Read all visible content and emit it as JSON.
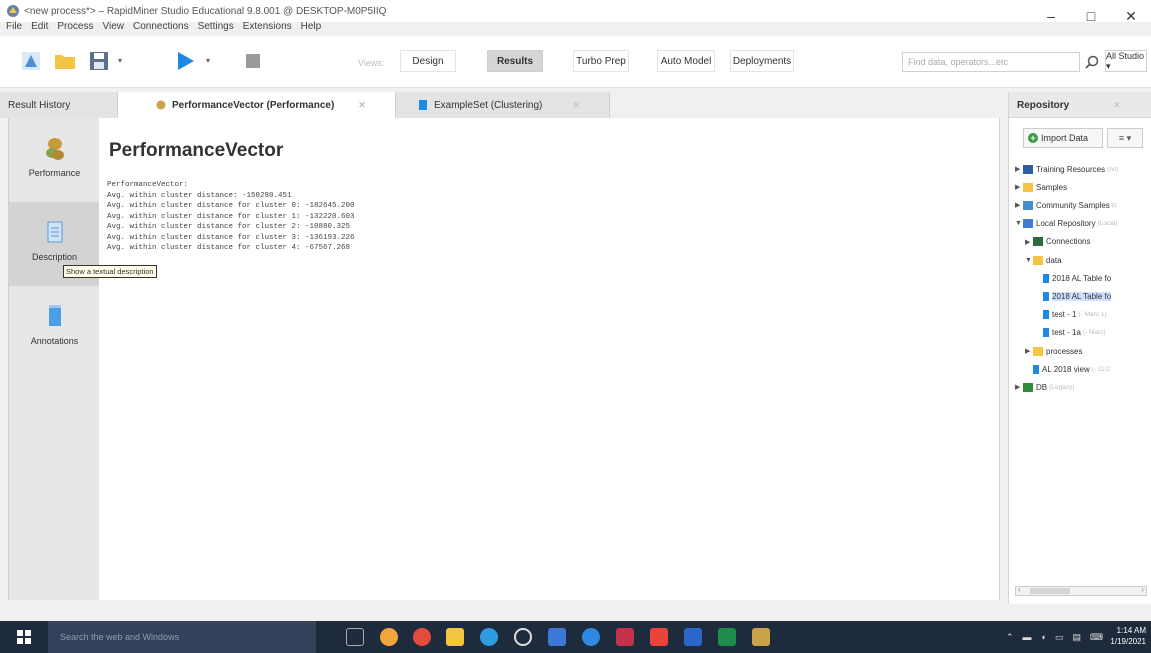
{
  "window": {
    "title": "<new process*> – RapidMiner Studio Educational 9.8.001 @ DESKTOP-M0P5IIQ",
    "minimize": "–",
    "maximize": "□",
    "close": "✕"
  },
  "menubar": [
    "File",
    "Edit",
    "Process",
    "View",
    "Connections",
    "Settings",
    "Extensions",
    "Help"
  ],
  "toolbar": {
    "views_label": "Views:",
    "views": [
      "Design",
      "Results",
      "Turbo Prep",
      "Auto Model",
      "Deployments"
    ],
    "active_view": "Results",
    "search_placeholder": "Find data, operators...etc",
    "studio_dropdown": "All Studio ▾"
  },
  "tabs": [
    {
      "label": "Result History",
      "active": false
    },
    {
      "label": "PerformanceVector (Performance)",
      "active": true
    },
    {
      "label": "ExampleSet (Clustering)",
      "active": false
    }
  ],
  "sidebar": {
    "items": [
      {
        "label": "Performance"
      },
      {
        "label": "Description"
      },
      {
        "label": "Annotations"
      }
    ],
    "tooltip": "Show a textual description"
  },
  "main": {
    "heading": "PerformanceVector",
    "lines": [
      "PerformanceVector:",
      "Avg. within cluster distance: -150280.451",
      "Avg. within cluster distance for cluster 0: -182645.200",
      "Avg. within cluster distance for cluster 1: -132220.603",
      "Avg. within cluster distance for cluster 2: -10880.325",
      "Avg. within cluster distance for cluster 3: -136193.226",
      "Avg. within cluster distance for cluster 4: -67567.268"
    ]
  },
  "repository": {
    "title": "Repository",
    "import_label": "Import Data",
    "menu_label": "≡ ▾",
    "tree": [
      {
        "label": "Training Resources",
        "meta": "(no)",
        "indent": 0,
        "twisty": "▶",
        "icon": "training"
      },
      {
        "label": "Samples",
        "meta": "",
        "indent": 0,
        "twisty": "▶",
        "icon": "folder"
      },
      {
        "label": "Community Samples",
        "meta": "(c",
        "indent": 0,
        "twisty": "▶",
        "icon": "community"
      },
      {
        "label": "Local Repository",
        "meta": "(Local)",
        "indent": 0,
        "twisty": "▼",
        "icon": "localrepo"
      },
      {
        "label": "Connections",
        "meta": "",
        "indent": 1,
        "twisty": "▶",
        "icon": "connections"
      },
      {
        "label": "data",
        "meta": "",
        "indent": 1,
        "twisty": "▼",
        "icon": "folder"
      },
      {
        "label": "2018 AL Table fo",
        "meta": "",
        "indent": 2,
        "twisty": "",
        "icon": "data",
        "selected": false
      },
      {
        "label": "2018 AL Table fo",
        "meta": "",
        "indent": 2,
        "twisty": "",
        "icon": "data",
        "selected": true
      },
      {
        "label": "test - 1",
        "meta": "(- Marc 1)",
        "indent": 2,
        "twisty": "",
        "icon": "data"
      },
      {
        "label": "test - 1a",
        "meta": "(- Marc)",
        "indent": 2,
        "twisty": "",
        "icon": "data"
      },
      {
        "label": "processes",
        "meta": "",
        "indent": 1,
        "twisty": "▶",
        "icon": "folder"
      },
      {
        "label": "AL 2018 view",
        "meta": "(- 11/2",
        "indent": 1,
        "twisty": "",
        "icon": "data"
      },
      {
        "label": "DB",
        "meta": "(Legacy)",
        "indent": 0,
        "twisty": "▶",
        "icon": "db"
      }
    ]
  },
  "taskbar": {
    "search_placeholder": "Search the web and Windows",
    "time": "1:14 AM",
    "date": "1/19/2021"
  },
  "colors": {
    "accent_blue": "#1e88e5",
    "folder_yellow": "#f4c542",
    "taskbar": "#1e2b3d"
  }
}
